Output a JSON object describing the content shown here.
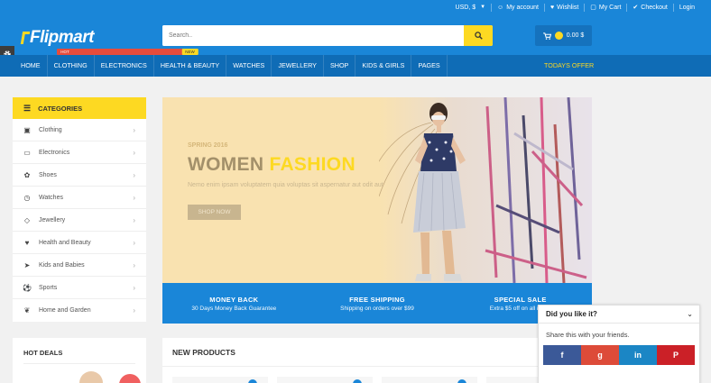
{
  "topbar": {
    "currency": "USD, $",
    "my_account": "My account",
    "wishlist": "Wishlist",
    "my_cart": "My Cart",
    "checkout": "Checkout",
    "login": "Login"
  },
  "header": {
    "logo": "Flipmart",
    "search_placeholder": "Search..",
    "cart_total": "0.00 $"
  },
  "nav": {
    "items": [
      "HOME",
      "CLOTHING",
      "ELECTRONICS",
      "HEALTH & BEAUTY",
      "WATCHES",
      "JEWELLERY",
      "SHOP",
      "KIDS & GIRLS",
      "PAGES"
    ],
    "hot_badge": "HOT",
    "new_badge": "NEW",
    "offer": "TODAYS OFFER"
  },
  "categories": {
    "title": "CATEGORIES",
    "items": [
      "Clothing",
      "Electronics",
      "Shoes",
      "Watches",
      "Jewellery",
      "Health and Beauty",
      "Kids and Babies",
      "Sports",
      "Home and Garden"
    ]
  },
  "hero": {
    "kicker": "SPRING 2016",
    "title_a": "WOMEN",
    "title_b": "FASHION",
    "desc": "Nemo enim ipsam voluptatem quia voluptas sit aspernatur aut odit aut",
    "cta": "SHOP NOW"
  },
  "info": [
    {
      "title": "MONEY BACK",
      "sub": "30 Days Money Back Guarantee"
    },
    {
      "title": "FREE SHIPPING",
      "sub": "Shipping on orders over $99"
    },
    {
      "title": "SPECIAL SALE",
      "sub": "Extra $5 off on all items"
    }
  ],
  "hot_deals": {
    "title": "HOT DEALS"
  },
  "new_products": {
    "title": "NEW PRODUCTS"
  },
  "share": {
    "question": "Did you like it?",
    "message": "Share this with your friends.",
    "facebook": "f",
    "google": "g",
    "linkedin": "in",
    "pinterest": "P"
  },
  "colors": {
    "brand_blue": "#1a86d8",
    "nav_blue": "#0f6cb6",
    "accent_yellow": "#fdd922",
    "facebook": "#3b5998",
    "google": "#dd4b39",
    "linkedin": "#1b86c5",
    "pinterest": "#cb2027"
  },
  "icons": {
    "account": "user-icon",
    "wishlist": "heart-icon",
    "cart": "cart-icon",
    "checkout": "check-icon",
    "search": "search-icon",
    "settings": "gear-icon"
  }
}
